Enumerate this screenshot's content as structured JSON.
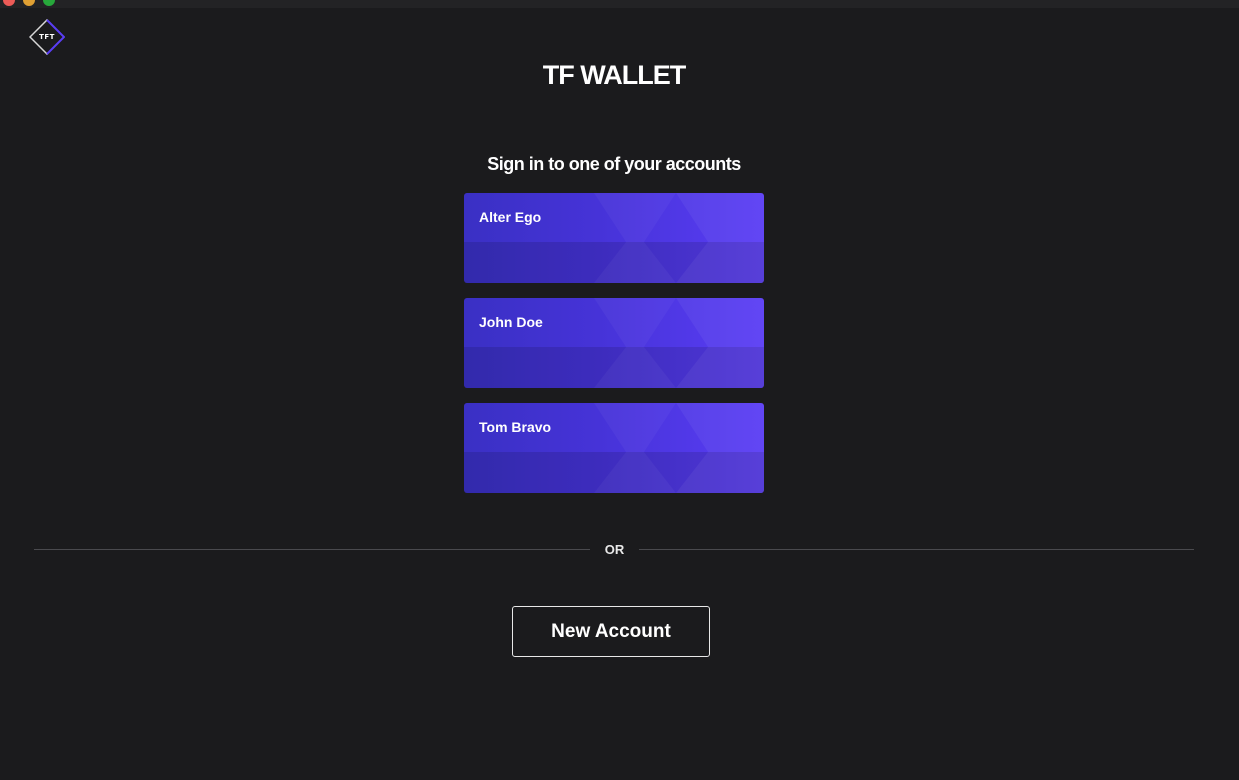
{
  "app": {
    "logo_text": "TFT",
    "title": "TF WALLET"
  },
  "signin": {
    "heading": "Sign in to one of your accounts",
    "accounts": [
      {
        "name": "Alter Ego"
      },
      {
        "name": "John Doe"
      },
      {
        "name": "Tom Bravo"
      }
    ]
  },
  "divider": {
    "label": "OR"
  },
  "actions": {
    "new_account_label": "New Account"
  },
  "colors": {
    "background": "#1b1b1d",
    "card_start": "#3a30c4",
    "card_end": "#5a3df5",
    "logo_accent": "#5a3df5"
  },
  "icons": {
    "logo": "tft-diamond-logo-icon"
  }
}
